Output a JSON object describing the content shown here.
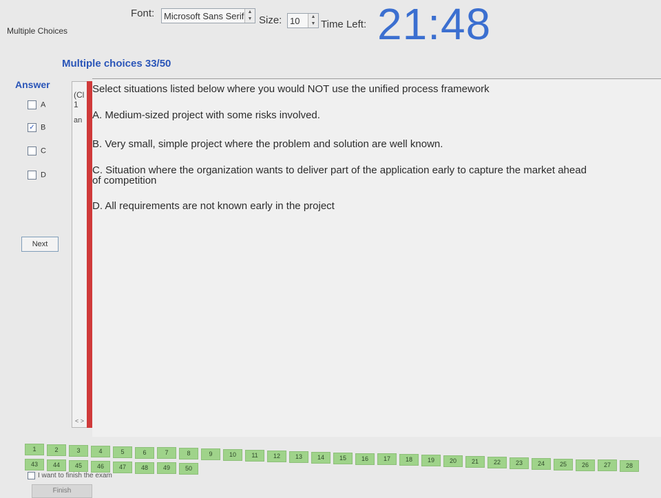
{
  "toolbar": {
    "font_label": "Font:",
    "font_value": "Microsoft Sans Serif",
    "size_label": "Size:",
    "size_value": "10",
    "time_label": "Time Left:",
    "time_value": "21:48"
  },
  "form_title": "Multiple Choices",
  "section_title": "Multiple choices 33/50",
  "answer": {
    "title": "Answer",
    "options": [
      {
        "label": "A",
        "checked": false
      },
      {
        "label": "B",
        "checked": true
      },
      {
        "label": "C",
        "checked": false
      },
      {
        "label": "D",
        "checked": false
      }
    ],
    "next_label": "Next"
  },
  "left_panel": {
    "fragments": [
      "(Cl",
      "1",
      "an"
    ],
    "scroll_arrows": "< >"
  },
  "question": {
    "text": "Select situations listed below where you would NOT use the unified process framework",
    "options": [
      "A. Medium-sized project with some risks involved.",
      "B. Very small, simple project where the problem and solution are well known.",
      "C. Situation where the organization wants to deliver part of the application early to capture the market ahead",
      "of competition",
      "D. All requirements are not known early in the project"
    ]
  },
  "pager": {
    "row1": [
      "1",
      "2",
      "3",
      "4",
      "5",
      "6",
      "7",
      "8",
      "9",
      "10",
      "11",
      "12",
      "13",
      "14",
      "15",
      "16",
      "17",
      "18",
      "19",
      "20",
      "21",
      "22",
      "23",
      "24",
      "25",
      "26",
      "27",
      "28"
    ],
    "row2": [
      "43",
      "44",
      "45",
      "46",
      "47",
      "48",
      "49",
      "50"
    ],
    "finish_check_label": "I want to finish the exam",
    "finish_button": "Finish"
  },
  "colors": {
    "accent": "#2a55b8",
    "timer": "#3b6fd0",
    "splitter": "#cf3a3a",
    "page_button": "#9fd38a"
  }
}
